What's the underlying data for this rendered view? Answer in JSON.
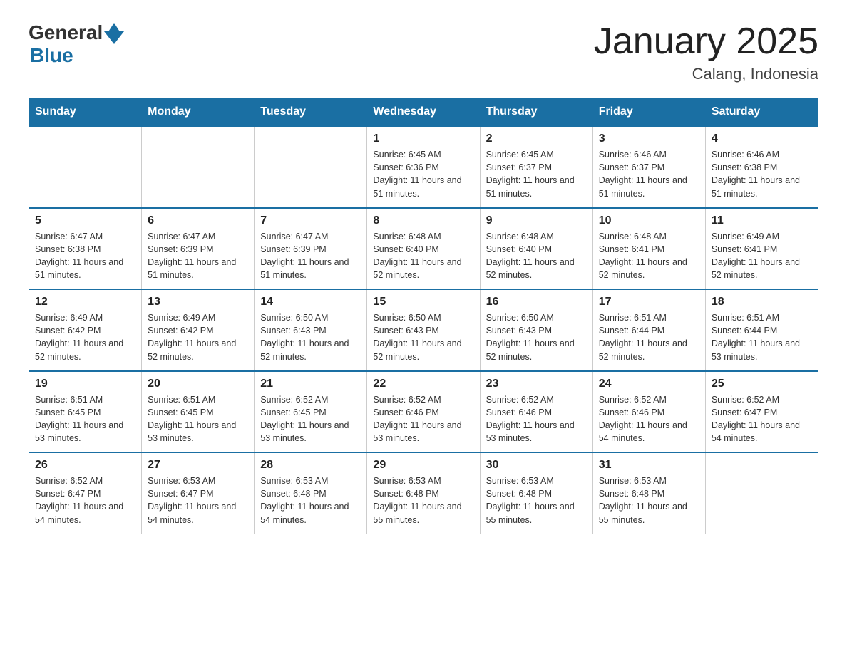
{
  "logo": {
    "general": "General",
    "blue": "Blue"
  },
  "title": "January 2025",
  "location": "Calang, Indonesia",
  "weekdays": [
    "Sunday",
    "Monday",
    "Tuesday",
    "Wednesday",
    "Thursday",
    "Friday",
    "Saturday"
  ],
  "weeks": [
    [
      {
        "day": "",
        "info": ""
      },
      {
        "day": "",
        "info": ""
      },
      {
        "day": "",
        "info": ""
      },
      {
        "day": "1",
        "info": "Sunrise: 6:45 AM\nSunset: 6:36 PM\nDaylight: 11 hours and 51 minutes."
      },
      {
        "day": "2",
        "info": "Sunrise: 6:45 AM\nSunset: 6:37 PM\nDaylight: 11 hours and 51 minutes."
      },
      {
        "day": "3",
        "info": "Sunrise: 6:46 AM\nSunset: 6:37 PM\nDaylight: 11 hours and 51 minutes."
      },
      {
        "day": "4",
        "info": "Sunrise: 6:46 AM\nSunset: 6:38 PM\nDaylight: 11 hours and 51 minutes."
      }
    ],
    [
      {
        "day": "5",
        "info": "Sunrise: 6:47 AM\nSunset: 6:38 PM\nDaylight: 11 hours and 51 minutes."
      },
      {
        "day": "6",
        "info": "Sunrise: 6:47 AM\nSunset: 6:39 PM\nDaylight: 11 hours and 51 minutes."
      },
      {
        "day": "7",
        "info": "Sunrise: 6:47 AM\nSunset: 6:39 PM\nDaylight: 11 hours and 51 minutes."
      },
      {
        "day": "8",
        "info": "Sunrise: 6:48 AM\nSunset: 6:40 PM\nDaylight: 11 hours and 52 minutes."
      },
      {
        "day": "9",
        "info": "Sunrise: 6:48 AM\nSunset: 6:40 PM\nDaylight: 11 hours and 52 minutes."
      },
      {
        "day": "10",
        "info": "Sunrise: 6:48 AM\nSunset: 6:41 PM\nDaylight: 11 hours and 52 minutes."
      },
      {
        "day": "11",
        "info": "Sunrise: 6:49 AM\nSunset: 6:41 PM\nDaylight: 11 hours and 52 minutes."
      }
    ],
    [
      {
        "day": "12",
        "info": "Sunrise: 6:49 AM\nSunset: 6:42 PM\nDaylight: 11 hours and 52 minutes."
      },
      {
        "day": "13",
        "info": "Sunrise: 6:49 AM\nSunset: 6:42 PM\nDaylight: 11 hours and 52 minutes."
      },
      {
        "day": "14",
        "info": "Sunrise: 6:50 AM\nSunset: 6:43 PM\nDaylight: 11 hours and 52 minutes."
      },
      {
        "day": "15",
        "info": "Sunrise: 6:50 AM\nSunset: 6:43 PM\nDaylight: 11 hours and 52 minutes."
      },
      {
        "day": "16",
        "info": "Sunrise: 6:50 AM\nSunset: 6:43 PM\nDaylight: 11 hours and 52 minutes."
      },
      {
        "day": "17",
        "info": "Sunrise: 6:51 AM\nSunset: 6:44 PM\nDaylight: 11 hours and 52 minutes."
      },
      {
        "day": "18",
        "info": "Sunrise: 6:51 AM\nSunset: 6:44 PM\nDaylight: 11 hours and 53 minutes."
      }
    ],
    [
      {
        "day": "19",
        "info": "Sunrise: 6:51 AM\nSunset: 6:45 PM\nDaylight: 11 hours and 53 minutes."
      },
      {
        "day": "20",
        "info": "Sunrise: 6:51 AM\nSunset: 6:45 PM\nDaylight: 11 hours and 53 minutes."
      },
      {
        "day": "21",
        "info": "Sunrise: 6:52 AM\nSunset: 6:45 PM\nDaylight: 11 hours and 53 minutes."
      },
      {
        "day": "22",
        "info": "Sunrise: 6:52 AM\nSunset: 6:46 PM\nDaylight: 11 hours and 53 minutes."
      },
      {
        "day": "23",
        "info": "Sunrise: 6:52 AM\nSunset: 6:46 PM\nDaylight: 11 hours and 53 minutes."
      },
      {
        "day": "24",
        "info": "Sunrise: 6:52 AM\nSunset: 6:46 PM\nDaylight: 11 hours and 54 minutes."
      },
      {
        "day": "25",
        "info": "Sunrise: 6:52 AM\nSunset: 6:47 PM\nDaylight: 11 hours and 54 minutes."
      }
    ],
    [
      {
        "day": "26",
        "info": "Sunrise: 6:52 AM\nSunset: 6:47 PM\nDaylight: 11 hours and 54 minutes."
      },
      {
        "day": "27",
        "info": "Sunrise: 6:53 AM\nSunset: 6:47 PM\nDaylight: 11 hours and 54 minutes."
      },
      {
        "day": "28",
        "info": "Sunrise: 6:53 AM\nSunset: 6:48 PM\nDaylight: 11 hours and 54 minutes."
      },
      {
        "day": "29",
        "info": "Sunrise: 6:53 AM\nSunset: 6:48 PM\nDaylight: 11 hours and 55 minutes."
      },
      {
        "day": "30",
        "info": "Sunrise: 6:53 AM\nSunset: 6:48 PM\nDaylight: 11 hours and 55 minutes."
      },
      {
        "day": "31",
        "info": "Sunrise: 6:53 AM\nSunset: 6:48 PM\nDaylight: 11 hours and 55 minutes."
      },
      {
        "day": "",
        "info": ""
      }
    ]
  ]
}
